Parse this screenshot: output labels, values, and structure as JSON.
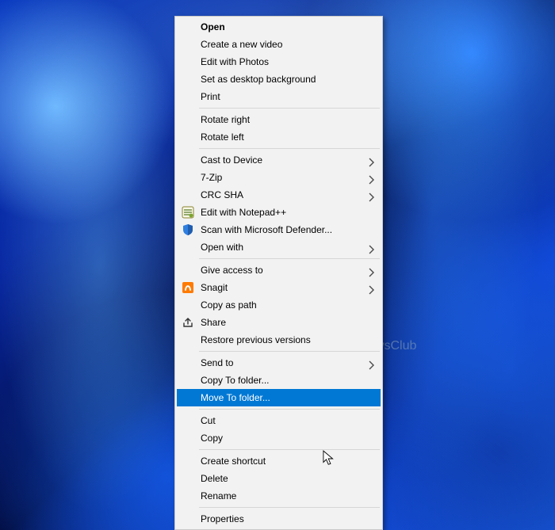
{
  "watermark": {
    "text": "TheWindowsClub"
  },
  "context_menu": {
    "groups": [
      [
        {
          "id": "open",
          "label": "Open",
          "bold": true
        },
        {
          "id": "new-video",
          "label": "Create a new video"
        },
        {
          "id": "edit-photos",
          "label": "Edit with Photos"
        },
        {
          "id": "set-bg",
          "label": "Set as desktop background"
        },
        {
          "id": "print",
          "label": "Print"
        }
      ],
      [
        {
          "id": "rotate-right",
          "label": "Rotate right"
        },
        {
          "id": "rotate-left",
          "label": "Rotate left"
        }
      ],
      [
        {
          "id": "cast",
          "label": "Cast to Device",
          "submenu": true
        },
        {
          "id": "7zip",
          "label": "7-Zip",
          "submenu": true
        },
        {
          "id": "crc-sha",
          "label": "CRC SHA",
          "submenu": true
        },
        {
          "id": "notepadpp",
          "label": "Edit with Notepad++",
          "icon": "notepadpp-icon"
        },
        {
          "id": "defender",
          "label": "Scan with Microsoft Defender...",
          "icon": "shield-icon"
        },
        {
          "id": "open-with",
          "label": "Open with",
          "submenu": true
        }
      ],
      [
        {
          "id": "give-access",
          "label": "Give access to",
          "submenu": true
        },
        {
          "id": "snagit",
          "label": "Snagit",
          "submenu": true,
          "icon": "snagit-icon"
        },
        {
          "id": "copy-path",
          "label": "Copy as path"
        },
        {
          "id": "share",
          "label": "Share",
          "icon": "share-icon"
        },
        {
          "id": "restore-prev",
          "label": "Restore previous versions"
        }
      ],
      [
        {
          "id": "send-to",
          "label": "Send to",
          "submenu": true
        },
        {
          "id": "copy-to",
          "label": "Copy To folder..."
        },
        {
          "id": "move-to",
          "label": "Move To folder...",
          "selected": true
        }
      ],
      [
        {
          "id": "cut",
          "label": "Cut"
        },
        {
          "id": "copy",
          "label": "Copy"
        }
      ],
      [
        {
          "id": "shortcut",
          "label": "Create shortcut"
        },
        {
          "id": "delete",
          "label": "Delete"
        },
        {
          "id": "rename",
          "label": "Rename"
        }
      ],
      [
        {
          "id": "properties",
          "label": "Properties"
        }
      ]
    ]
  }
}
